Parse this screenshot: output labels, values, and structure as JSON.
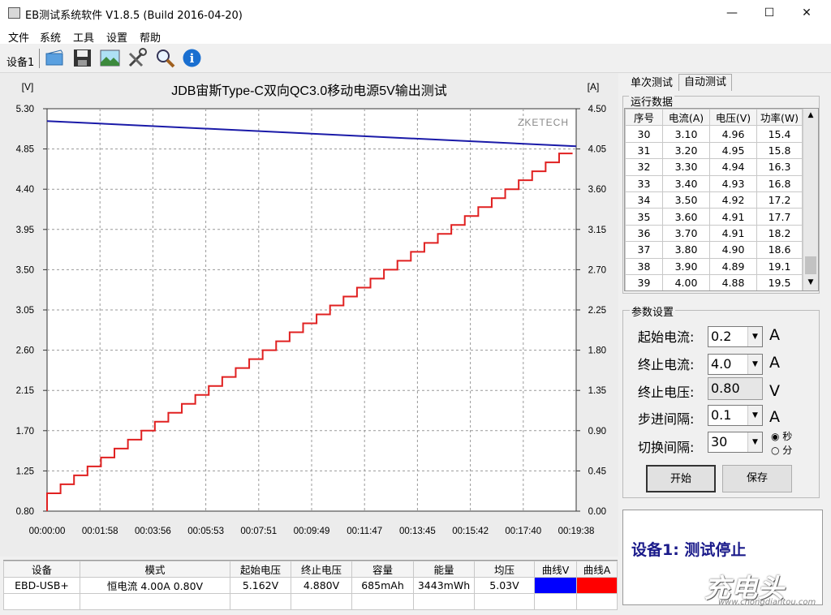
{
  "window": {
    "title": "EB测试系统软件 V1.8.5 (Build 2016-04-20)",
    "minimize": "—",
    "maximize": "☐",
    "close": "✕"
  },
  "menu": [
    "文件",
    "系统",
    "工具",
    "设置",
    "帮助"
  ],
  "toolbar": {
    "device_label": "设备1",
    "icons": [
      "open-folder-icon",
      "save-icon",
      "image-icon",
      "tools-icon",
      "zoom-icon",
      "info-icon"
    ]
  },
  "chart_data": {
    "type": "line",
    "title": "JDB宙斯Type-C双向QC3.0移动电源5V输出测试",
    "watermark": "ZKETECH",
    "ylabel_left": "[V]",
    "ylabel_right": "[A]",
    "y_left_ticks": [
      "5.30",
      "4.85",
      "4.40",
      "3.95",
      "3.50",
      "3.05",
      "2.60",
      "2.15",
      "1.70",
      "1.25",
      "0.80"
    ],
    "y_right_ticks": [
      "4.50",
      "4.05",
      "3.60",
      "3.15",
      "2.70",
      "2.25",
      "1.80",
      "1.35",
      "0.90",
      "0.45",
      "0.00"
    ],
    "x_ticks": [
      "00:00:00",
      "00:01:58",
      "00:03:56",
      "00:05:53",
      "00:07:51",
      "00:09:49",
      "00:11:47",
      "00:13:45",
      "00:15:42",
      "00:17:40",
      "00:19:38"
    ],
    "ylim_left": [
      0.8,
      5.3
    ],
    "ylim_right": [
      0.0,
      4.5
    ],
    "grid": true,
    "series": [
      {
        "axis": "left",
        "color": "#1a1aa8",
        "x": [
          0,
          1178
        ],
        "values": [
          5.162,
          4.88
        ]
      },
      {
        "axis": "right",
        "color": "#e02020",
        "stepped": true,
        "x_step_seconds": 30,
        "values": [
          0.2,
          0.3,
          0.4,
          0.5,
          0.6,
          0.7,
          0.8,
          0.9,
          1.0,
          1.1,
          1.2,
          1.3,
          1.4,
          1.5,
          1.6,
          1.7,
          1.8,
          1.9,
          2.0,
          2.1,
          2.2,
          2.3,
          2.4,
          2.5,
          2.6,
          2.7,
          2.8,
          2.9,
          3.0,
          3.1,
          3.2,
          3.3,
          3.4,
          3.5,
          3.6,
          3.7,
          3.8,
          3.9,
          4.0
        ]
      }
    ]
  },
  "tabs": [
    "单次测试",
    "自动测试"
  ],
  "run_data": {
    "title": "运行数据",
    "columns": [
      "序号",
      "电流(A)",
      "电压(V)",
      "功率(W)"
    ],
    "rows": [
      [
        "30",
        "3.10",
        "4.96",
        "15.4"
      ],
      [
        "31",
        "3.20",
        "4.95",
        "15.8"
      ],
      [
        "32",
        "3.30",
        "4.94",
        "16.3"
      ],
      [
        "33",
        "3.40",
        "4.93",
        "16.8"
      ],
      [
        "34",
        "3.50",
        "4.92",
        "17.2"
      ],
      [
        "35",
        "3.60",
        "4.91",
        "17.7"
      ],
      [
        "36",
        "3.70",
        "4.91",
        "18.2"
      ],
      [
        "37",
        "3.80",
        "4.90",
        "18.6"
      ],
      [
        "38",
        "3.90",
        "4.89",
        "19.1"
      ],
      [
        "39",
        "4.00",
        "4.88",
        "19.5"
      ]
    ]
  },
  "params": {
    "title": "参数设置",
    "start_current_label": "起始电流:",
    "start_current_value": "0.2",
    "start_current_unit": "A",
    "end_current_label": "终止电流:",
    "end_current_value": "4.0",
    "end_current_unit": "A",
    "end_voltage_label": "终止电压:",
    "end_voltage_value": "0.80",
    "end_voltage_unit": "V",
    "step_label": "步进间隔:",
    "step_value": "0.1",
    "step_unit": "A",
    "switch_label": "切换间隔:",
    "switch_value": "30",
    "unit_sec": "秒",
    "unit_min": "分",
    "start_button": "开始",
    "save_button": "保存"
  },
  "status": "设备1: 测试停止",
  "summary": {
    "columns": [
      "设备",
      "模式",
      "起始电压",
      "终止电压",
      "容量",
      "能量",
      "均压",
      "曲线V",
      "曲线A"
    ],
    "row": [
      "EBD-USB+",
      "恒电流  4.00A  0.80V",
      "5.162V",
      "4.880V",
      "685mAh",
      "3443mWh",
      "5.03V"
    ],
    "curve_v_color": "#0000ff",
    "curve_a_color": "#ff0000"
  },
  "watermark": {
    "brand": "充电头",
    "url": "www.chongdiantou.com"
  }
}
